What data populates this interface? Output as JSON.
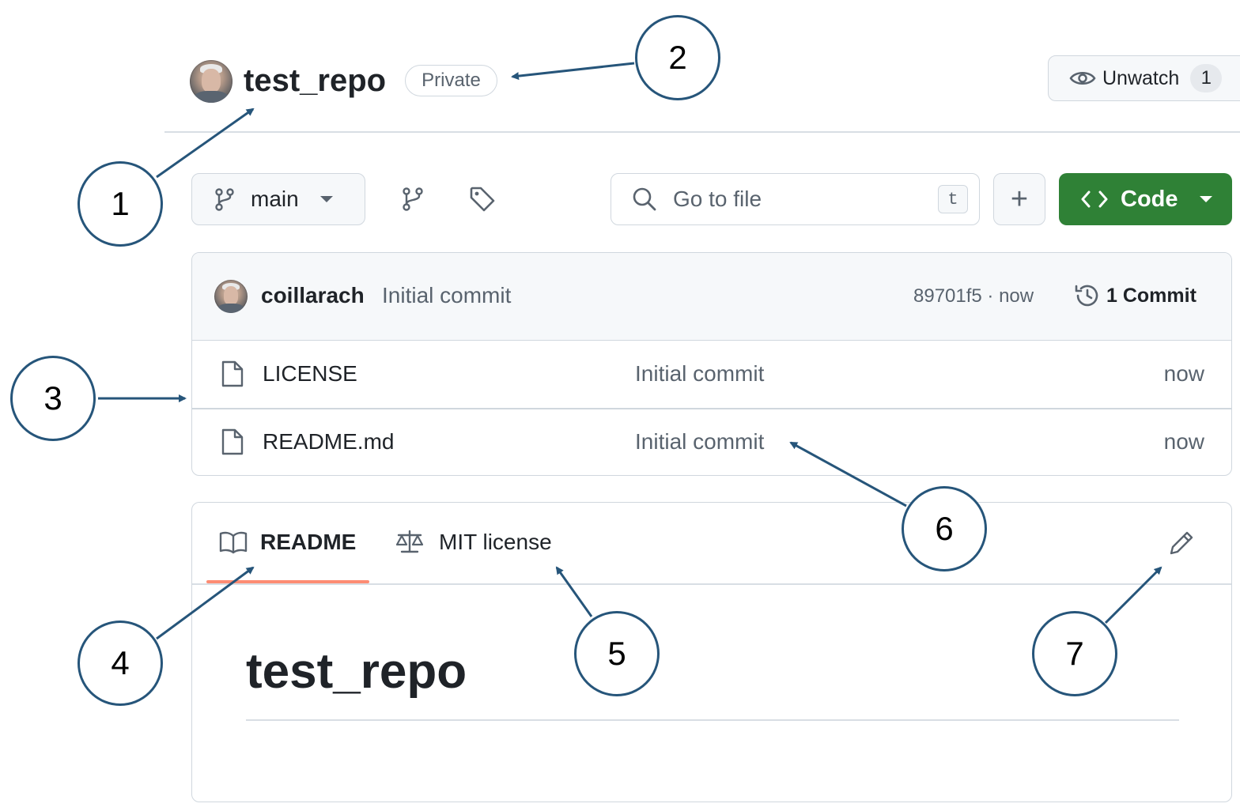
{
  "header": {
    "repo_name": "test_repo",
    "visibility_badge": "Private",
    "unwatch_label": "Unwatch",
    "unwatch_count": "1"
  },
  "toolbar": {
    "branch_name": "main",
    "search_placeholder": "Go to file",
    "search_shortcut": "t",
    "add_label": "+",
    "code_label": "Code"
  },
  "latest_commit": {
    "author": "coillarach",
    "message": "Initial commit",
    "hash_time": "89701f5 · now",
    "commit_count_label": "1 Commit"
  },
  "files": [
    {
      "name": "LICENSE",
      "message": "Initial commit",
      "time": "now",
      "icon": "file-icon"
    },
    {
      "name": "README.md",
      "message": "Initial commit",
      "time": "now",
      "icon": "file-icon"
    }
  ],
  "readme": {
    "tabs": [
      {
        "label": "README",
        "icon": "book-icon",
        "active": true
      },
      {
        "label": "MIT license",
        "icon": "law-icon",
        "active": false
      }
    ],
    "heading": "test_repo"
  },
  "callouts": [
    "1",
    "2",
    "3",
    "4",
    "5",
    "6",
    "7"
  ],
  "colors": {
    "accent_green": "#2f8136",
    "tab_underline": "#fd8c73",
    "callout_stroke": "#26557a",
    "border": "#d0d7de",
    "muted_text": "#59636e"
  }
}
